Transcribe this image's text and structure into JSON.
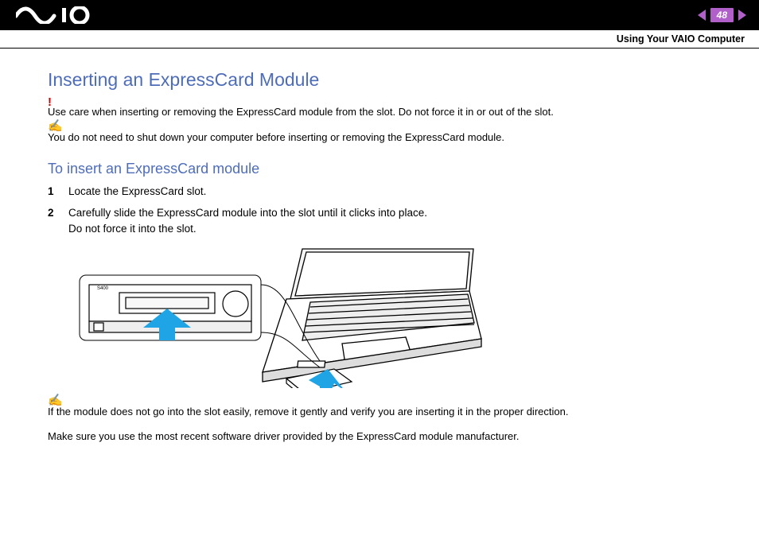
{
  "header": {
    "page_number": "48",
    "section": "Using Your VAIO Computer"
  },
  "title": "Inserting an ExpressCard Module",
  "warning": "Use care when inserting or removing the ExpressCard module from the slot. Do not force it in or out of the slot.",
  "tip1": "You do not need to shut down your computer before inserting or removing the ExpressCard module.",
  "subtitle": "To insert an ExpressCard module",
  "steps": [
    {
      "num": "1",
      "text": "Locate the ExpressCard slot."
    },
    {
      "num": "2",
      "text": "Carefully slide the ExpressCard module into the slot until it clicks into place.\nDo not force it into the slot."
    }
  ],
  "tip2": "If the module does not go into the slot easily, remove it gently and verify you are inserting it in the proper direction.",
  "note": "Make sure you use the most recent software driver provided by the ExpressCard module manufacturer.",
  "icons": {
    "warn_mark": "!",
    "tip_mark": "✍"
  }
}
